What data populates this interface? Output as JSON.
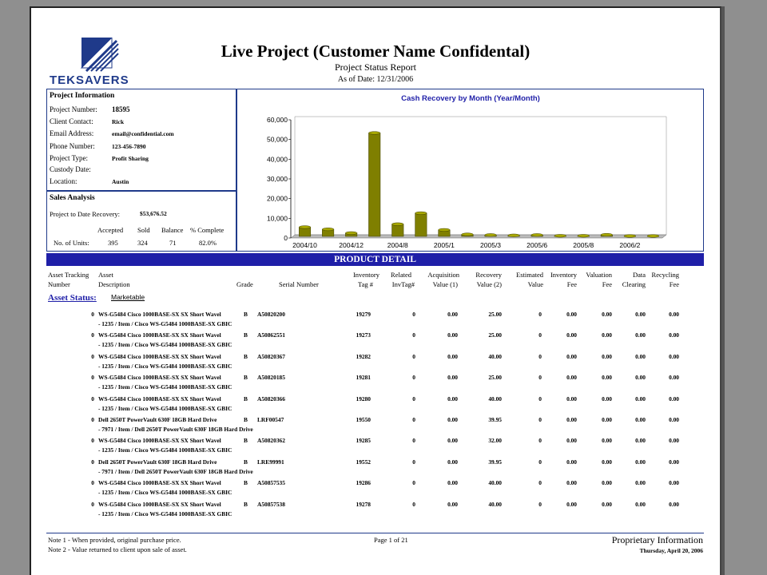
{
  "header": {
    "logo_text": "TEKSAVERS",
    "title": "Live Project (Customer Name Confidental)",
    "subtitle": "Project Status Report",
    "as_of": "As of Date: 12/31/2006"
  },
  "project_info": {
    "heading": "Project Information",
    "rows": [
      {
        "label": "Project Number:",
        "value": "18595"
      },
      {
        "label": "Client Contact:",
        "value": "Rick"
      },
      {
        "label": "Email Address:",
        "value": "email@confidential.com"
      },
      {
        "label": "Phone Number:",
        "value": "123-456-7890"
      },
      {
        "label": "Project Type:",
        "value": "Profit Sharing"
      },
      {
        "label": "Custody Date:",
        "value": ""
      },
      {
        "label": "Location:",
        "value": "Austin"
      }
    ]
  },
  "sales_analysis": {
    "heading": "Sales Analysis",
    "recovery_label": "Project to Date Recovery:",
    "recovery_value": "$53,676.52",
    "col_accepted": "Accepted",
    "col_sold": "Sold",
    "col_balance": "Balance",
    "col_complete": "% Complete",
    "units_label": "No. of Units:",
    "accepted": "395",
    "sold": "324",
    "balance": "71",
    "complete": "82.0%"
  },
  "chart_data": {
    "type": "bar",
    "title": "Cash Recovery by Month (Year/Month)",
    "xlabel": "",
    "ylabel": "",
    "ylim": [
      0,
      60000
    ],
    "yticks": [
      "0",
      "10,000",
      "20,000",
      "30,000",
      "40,000",
      "50,000",
      "60,000"
    ],
    "xtick_labels": [
      "2004/10",
      "2004/12",
      "2004/8",
      "2005/1",
      "2005/3",
      "2005/6",
      "2005/8",
      "2006/2"
    ],
    "values": [
      4700,
      3600,
      1700,
      52500,
      6200,
      11800,
      3300,
      1000,
      700,
      500,
      700,
      300,
      300,
      800,
      200,
      200
    ],
    "bar_color": "#7f7f00",
    "grid": false,
    "legend": "none"
  },
  "product_detail": {
    "band": "PRODUCT DETAIL",
    "headers": {
      "h1a": "Asset Tracking",
      "h1b": "Number",
      "h2a": "Asset",
      "h2b": "Description",
      "h3": "Grade",
      "h4": "Serial Number",
      "h5a": "Inventory",
      "h5b": "Tag #",
      "h6a": "Related",
      "h6b": "InvTag#",
      "h7a": "Acquisition",
      "h7b": "Value (1)",
      "h8a": "Recovery",
      "h8b": "Value (2)",
      "h9a": "Estimated",
      "h9b": "Value",
      "h10a": "Inventory",
      "h10b": "Fee",
      "h11a": "Valuation",
      "h11b": "Fee",
      "h12a": "Data",
      "h12b": "Clearing",
      "h13a": "Recycling",
      "h13b": "Fee"
    },
    "asset_status_label": "Asset Status:",
    "asset_status_value": "Marketable",
    "items": [
      {
        "num": "0",
        "desc": "WS-G5484 Cisco 1000BASE-SX SX Short Wavel",
        "sub": "- 1235 / Item / Cisco WS-G5484 1000BASE-SX GBIC",
        "grade": "B",
        "serial": "A50820200",
        "tag": "19279",
        "rel": "0",
        "acq": "0.00",
        "rec": "25.00",
        "est": "0",
        "inv": "0.00",
        "valf": "0.00",
        "data": "0.00",
        "recy": "0.00"
      },
      {
        "num": "0",
        "desc": "WS-G5484 Cisco 1000BASE-SX SX Short Wavel",
        "sub": "- 1235 / Item / Cisco WS-G5484 1000BASE-SX GBIC",
        "grade": "B",
        "serial": "A50862551",
        "tag": "19273",
        "rel": "0",
        "acq": "0.00",
        "rec": "25.00",
        "est": "0",
        "inv": "0.00",
        "valf": "0.00",
        "data": "0.00",
        "recy": "0.00"
      },
      {
        "num": "0",
        "desc": "WS-G5484 Cisco 1000BASE-SX SX Short Wavel",
        "sub": "- 1235 / Item / Cisco WS-G5484 1000BASE-SX GBIC",
        "grade": "B",
        "serial": "A50820367",
        "tag": "19282",
        "rel": "0",
        "acq": "0.00",
        "rec": "40.00",
        "est": "0",
        "inv": "0.00",
        "valf": "0.00",
        "data": "0.00",
        "recy": "0.00"
      },
      {
        "num": "0",
        "desc": "WS-G5484 Cisco 1000BASE-SX SX Short Wavel",
        "sub": "- 1235 / Item / Cisco WS-G5484 1000BASE-SX GBIC",
        "grade": "B",
        "serial": "A50820185",
        "tag": "19281",
        "rel": "0",
        "acq": "0.00",
        "rec": "25.00",
        "est": "0",
        "inv": "0.00",
        "valf": "0.00",
        "data": "0.00",
        "recy": "0.00"
      },
      {
        "num": "0",
        "desc": "WS-G5484 Cisco 1000BASE-SX SX Short Wavel",
        "sub": "- 1235 / Item / Cisco WS-G5484 1000BASE-SX GBIC",
        "grade": "B",
        "serial": "A50820366",
        "tag": "19280",
        "rel": "0",
        "acq": "0.00",
        "rec": "40.00",
        "est": "0",
        "inv": "0.00",
        "valf": "0.00",
        "data": "0.00",
        "recy": "0.00"
      },
      {
        "num": "0",
        "desc": "Dell 2650T PowerVault 630F 18GB Hard Drive",
        "sub": "- 7971 / Item / Dell 2650T PowerVault 630F 18GB Hard Drive",
        "grade": "B",
        "serial": "LRF00547",
        "tag": "19550",
        "rel": "0",
        "acq": "0.00",
        "rec": "39.95",
        "est": "0",
        "inv": "0.00",
        "valf": "0.00",
        "data": "0.00",
        "recy": "0.00"
      },
      {
        "num": "0",
        "desc": "WS-G5484 Cisco 1000BASE-SX SX Short Wavel",
        "sub": "- 1235 / Item / Cisco WS-G5484 1000BASE-SX GBIC",
        "grade": "B",
        "serial": "A50820362",
        "tag": "19285",
        "rel": "0",
        "acq": "0.00",
        "rec": "32.00",
        "est": "0",
        "inv": "0.00",
        "valf": "0.00",
        "data": "0.00",
        "recy": "0.00"
      },
      {
        "num": "0",
        "desc": "Dell 2650T PowerVault 630F 18GB Hard Drive",
        "sub": "- 7971 / Item / Dell 2650T PowerVault 630F 18GB Hard Drive",
        "grade": "B",
        "serial": "LRE99991",
        "tag": "19552",
        "rel": "0",
        "acq": "0.00",
        "rec": "39.95",
        "est": "0",
        "inv": "0.00",
        "valf": "0.00",
        "data": "0.00",
        "recy": "0.00"
      },
      {
        "num": "0",
        "desc": "WS-G5484 Cisco 1000BASE-SX SX Short Wavel",
        "sub": "- 1235 / Item / Cisco WS-G5484 1000BASE-SX GBIC",
        "grade": "B",
        "serial": "A50857535",
        "tag": "19286",
        "rel": "0",
        "acq": "0.00",
        "rec": "40.00",
        "est": "0",
        "inv": "0.00",
        "valf": "0.00",
        "data": "0.00",
        "recy": "0.00"
      },
      {
        "num": "0",
        "desc": "WS-G5484 Cisco 1000BASE-SX SX Short Wavel",
        "sub": "- 1235 / Item / Cisco WS-G5484 1000BASE-SX GBIC",
        "grade": "B",
        "serial": "A50857538",
        "tag": "19278",
        "rel": "0",
        "acq": "0.00",
        "rec": "40.00",
        "est": "0",
        "inv": "0.00",
        "valf": "0.00",
        "data": "0.00",
        "recy": "0.00"
      }
    ]
  },
  "footer": {
    "note1": "Note 1 - When provided, original purchase price.",
    "note2": "Note 2 - Value returned to client upon sale of asset.",
    "page": "Page 1 of 21",
    "proprietary": "Proprietary Information",
    "date": "Thursday, April 20, 2006"
  },
  "colors": {
    "accent": "#1f1fa8",
    "border": "#1f3a8a",
    "bar": "#7f7f00"
  }
}
